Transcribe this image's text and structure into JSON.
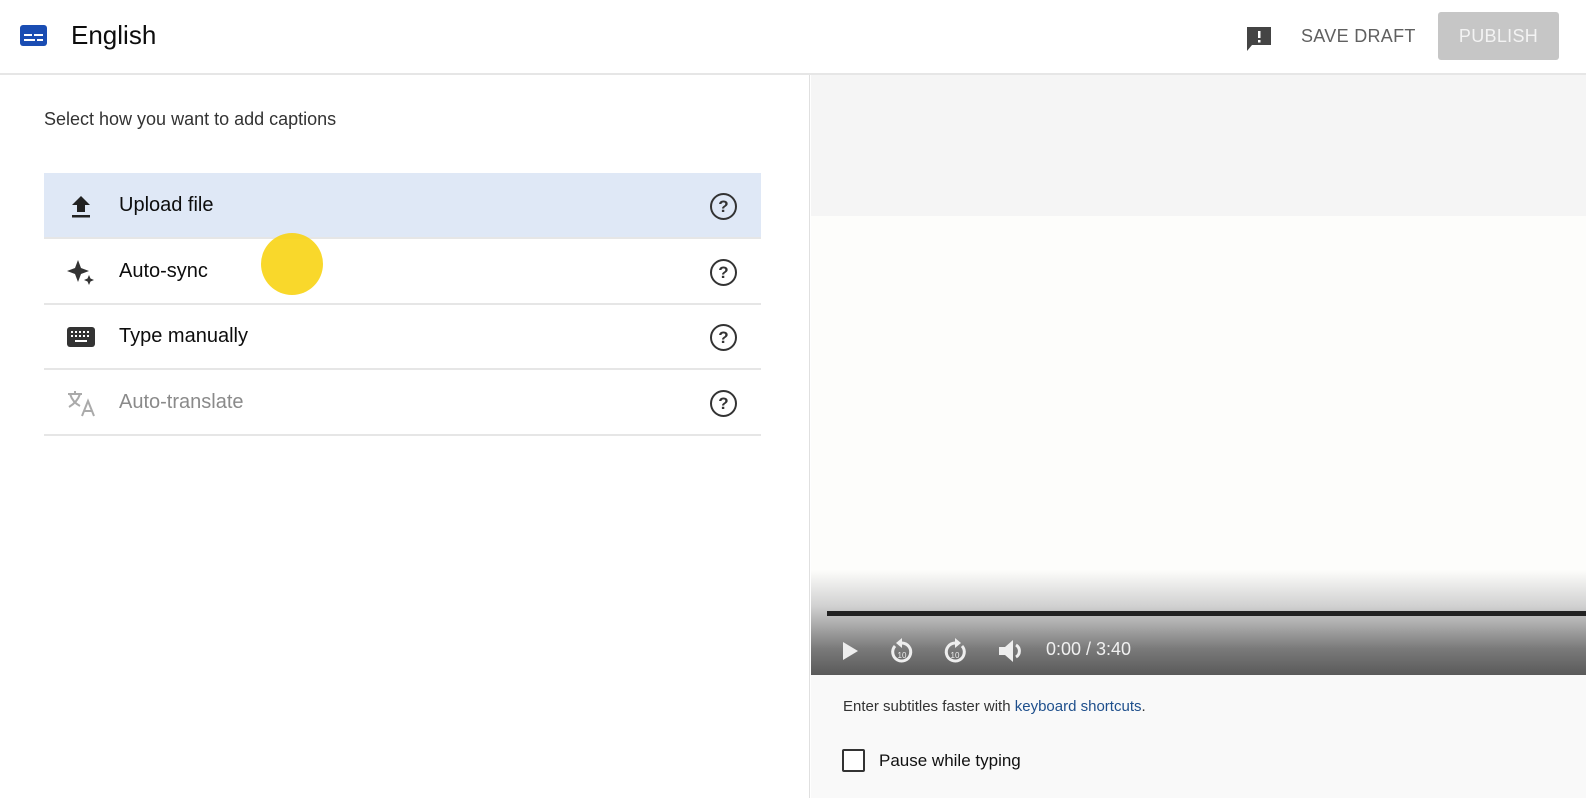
{
  "header": {
    "title": "English",
    "save_draft": "SAVE DRAFT",
    "publish": "PUBLISH",
    "brand_color": "#1a4db3"
  },
  "left": {
    "prompt": "Select how you want to add captions",
    "options": [
      {
        "label": "Upload file",
        "icon": "upload-icon",
        "selected": true,
        "disabled": false
      },
      {
        "label": "Auto-sync",
        "icon": "sparkle-icon",
        "selected": false,
        "disabled": false
      },
      {
        "label": "Type manually",
        "icon": "keyboard-icon",
        "selected": false,
        "disabled": false
      },
      {
        "label": "Auto-translate",
        "icon": "translate-icon",
        "selected": false,
        "disabled": true
      }
    ],
    "help_glyph": "?"
  },
  "player": {
    "time": "0:00 / 3:40",
    "rewind_seconds": "10",
    "forward_seconds": "10"
  },
  "hint": {
    "prefix": "Enter subtitles faster with ",
    "link": "keyboard shortcuts",
    "suffix": "."
  },
  "pause_while_typing": {
    "label": "Pause while typing",
    "checked": false
  }
}
